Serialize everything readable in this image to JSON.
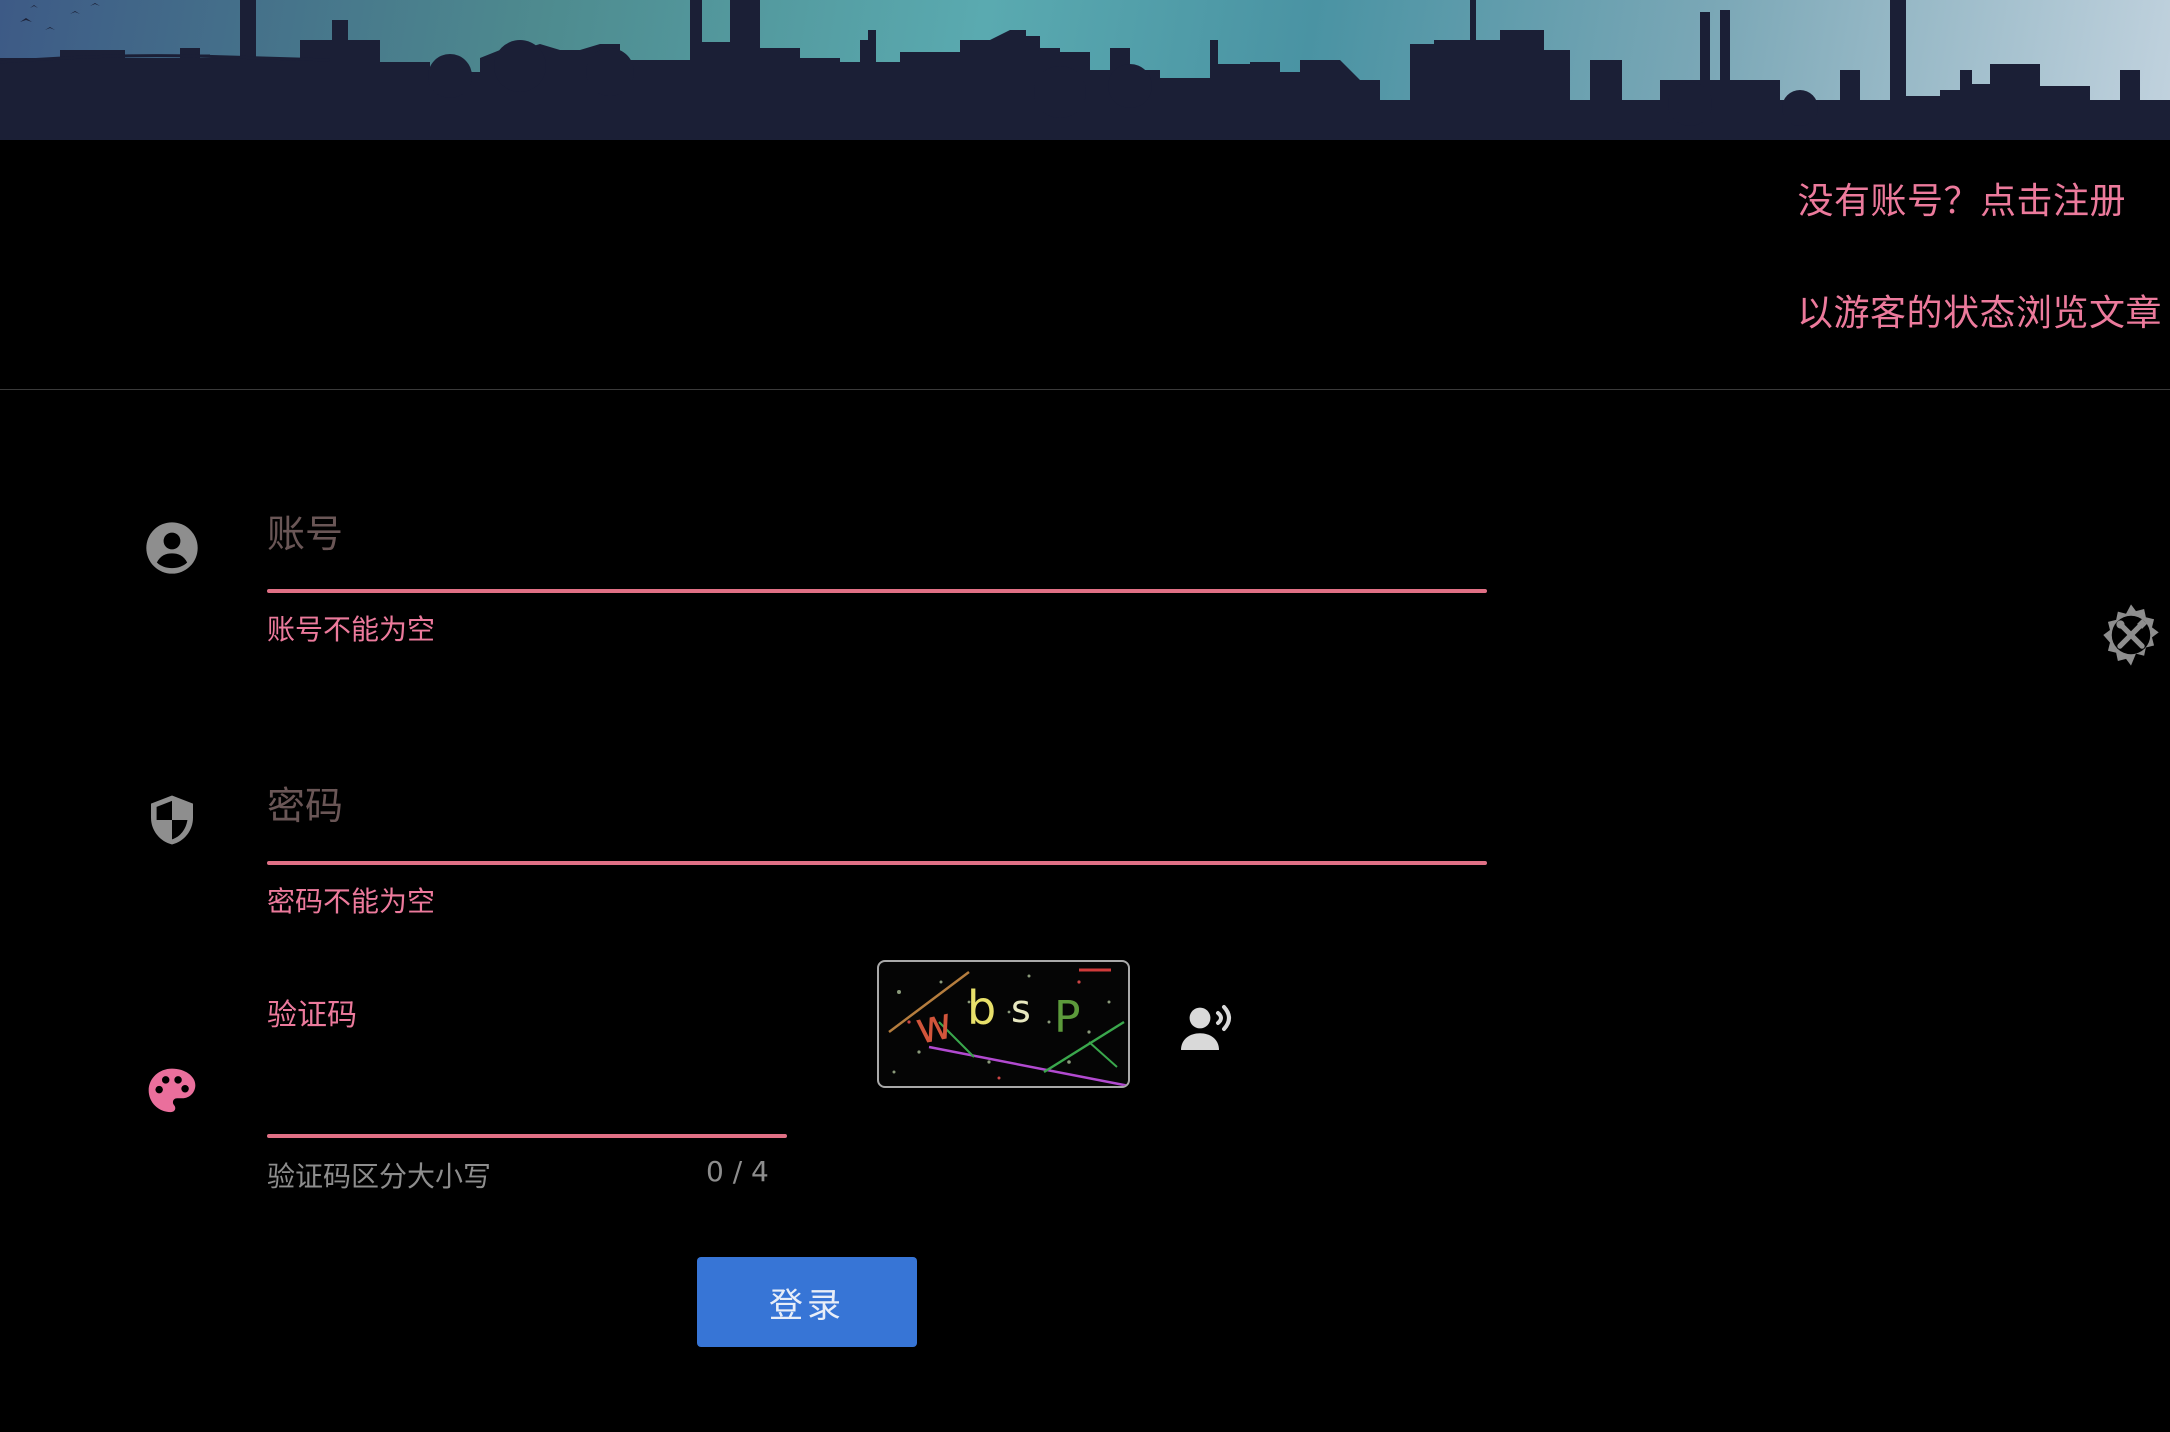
{
  "header": {
    "register_link": "没有账号？点击注册",
    "guest_link": "以游客的状态浏览文章"
  },
  "form": {
    "account": {
      "placeholder": "账号",
      "value": "",
      "error": "账号不能为空",
      "icon": "account-circle-icon"
    },
    "password": {
      "placeholder": "密码",
      "value": "",
      "error": "密码不能为空",
      "icon": "shield-icon"
    },
    "captcha": {
      "label": "验证码",
      "value": "",
      "hint": "验证码区分大小写",
      "counter": "0 / 4",
      "icon": "palette-icon",
      "image_text": "wbsP",
      "audio_icon": "voice-speaker-icon"
    },
    "login_button": "登录"
  },
  "side": {
    "settings_icon": "gear-tools-icon"
  },
  "colors": {
    "accent_pink": "#ec7a9c",
    "underline": "#e07085",
    "button_blue": "#3775d6",
    "background": "#000000"
  }
}
